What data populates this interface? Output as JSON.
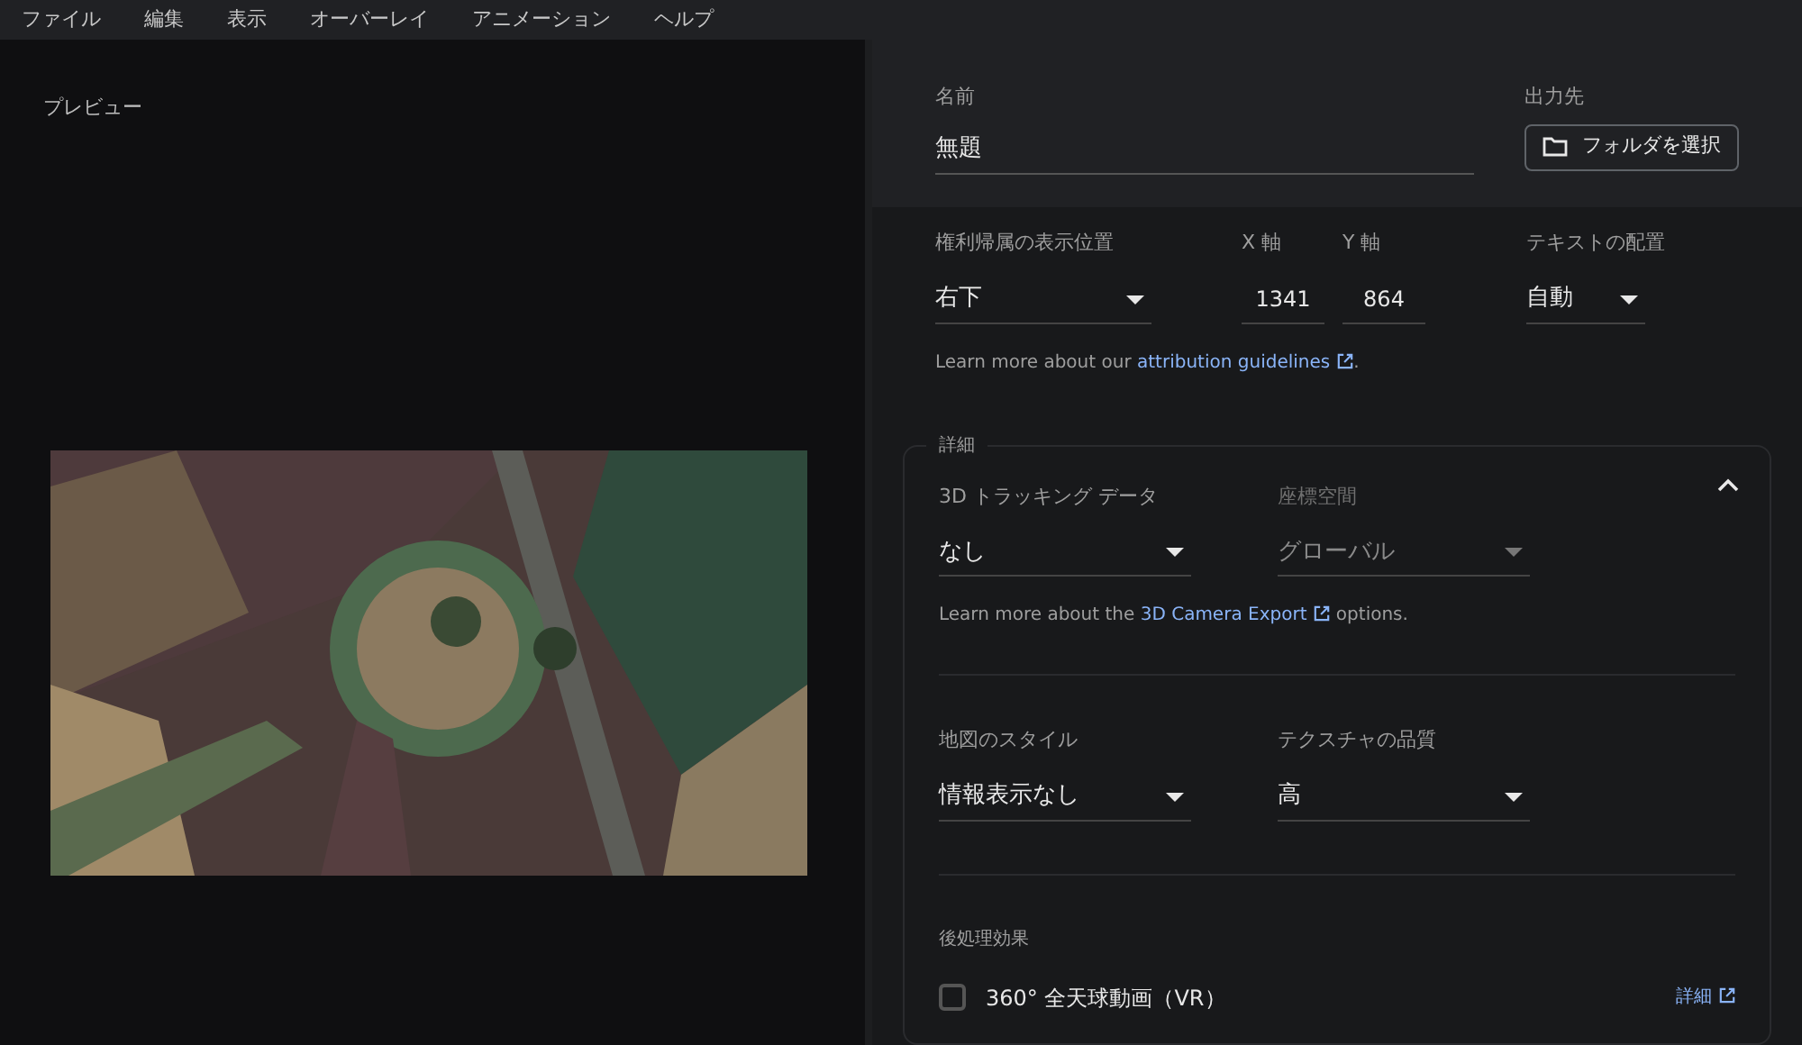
{
  "menu_bar": {
    "items": [
      "ファイル",
      "編集",
      "表示",
      "オーバーレイ",
      "アニメーション",
      "ヘルプ"
    ]
  },
  "preview": {
    "title": "プレビュー"
  },
  "output": {
    "name_label": "名前",
    "name_value": "無題",
    "destination_label": "出力先",
    "folder_button": "フォルダを選択"
  },
  "attribution": {
    "fields": [
      {
        "kind": "dropdown",
        "label": "権利帰属の表示位置",
        "value": "右下",
        "disabled": false
      },
      {
        "kind": "number",
        "label": "X 軸",
        "value": "1341",
        "disabled": false
      },
      {
        "kind": "number",
        "label": "Y 軸",
        "value": "864",
        "disabled": false
      },
      {
        "kind": "dropdown",
        "label": "テキストの配置",
        "value": "自動",
        "disabled": false
      }
    ],
    "help_before": "Learn more about our ",
    "help_link": "attribution guidelines",
    "help_after": "."
  },
  "details": {
    "legend": "詳細",
    "expanded": true,
    "tracking_fields": [
      {
        "kind": "dropdown",
        "label": "3D トラッキング データ",
        "value": "なし",
        "disabled": false
      },
      {
        "kind": "dropdown",
        "label": "座標空間",
        "value": "グローバル",
        "disabled": true
      }
    ],
    "tracking_help_before": "Learn more about the ",
    "tracking_help_link": "3D Camera Export",
    "tracking_help_after": " options.",
    "map_fields": [
      {
        "kind": "dropdown",
        "label": "地図のスタイル",
        "value": "情報表示なし",
        "disabled": false
      },
      {
        "kind": "dropdown",
        "label": "テクスチャの品質",
        "value": "高",
        "disabled": false
      }
    ],
    "post_label": "後処理効果",
    "effects": [
      {
        "label": "360° 全天球動画（VR）",
        "checked": false,
        "link": "詳細"
      }
    ]
  }
}
